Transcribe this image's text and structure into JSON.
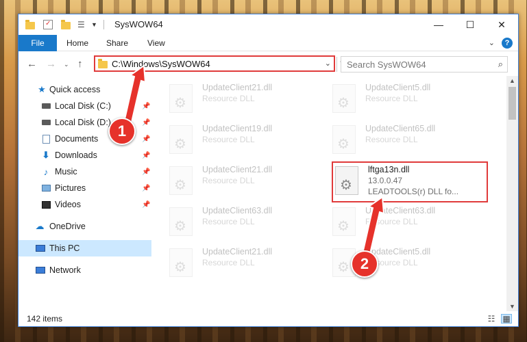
{
  "window": {
    "title": "SysWOW64",
    "controls": {
      "minimize": "—",
      "maximize": "☐",
      "close": "✕"
    }
  },
  "ribbon": {
    "tabs": [
      "File",
      "Home",
      "Share",
      "View"
    ],
    "help": "?"
  },
  "navigation": {
    "address": "C:\\Windows\\SysWOW64",
    "search_placeholder": "Search SysWOW64"
  },
  "sidebar": {
    "items": [
      {
        "label": "Quick access",
        "icon": "star-icon",
        "pinned": false
      },
      {
        "label": "Local Disk (C:)",
        "icon": "disk-icon",
        "pinned": true
      },
      {
        "label": "Local Disk (D:)",
        "icon": "disk-icon",
        "pinned": true
      },
      {
        "label": "Documents",
        "icon": "documents-icon",
        "pinned": true
      },
      {
        "label": "Downloads",
        "icon": "download-icon",
        "pinned": true
      },
      {
        "label": "Music",
        "icon": "music-icon",
        "pinned": true
      },
      {
        "label": "Pictures",
        "icon": "pictures-icon",
        "pinned": true
      },
      {
        "label": "Videos",
        "icon": "videos-icon",
        "pinned": true
      },
      {
        "label": "OneDrive",
        "icon": "cloud-icon",
        "pinned": false
      },
      {
        "label": "This PC",
        "icon": "computer-icon",
        "pinned": false,
        "selected": true
      },
      {
        "label": "Network",
        "icon": "network-icon",
        "pinned": false
      }
    ]
  },
  "files": [
    {
      "name": "UpdateClient21.dll",
      "type": "Resource DLL",
      "faded": true
    },
    {
      "name": "UpdateClient5.dll",
      "type": "Resource DLL",
      "faded": true
    },
    {
      "name": "UpdateClient19.dll",
      "type": "Resource DLL",
      "faded": true
    },
    {
      "name": "UpdateClient65.dll",
      "type": "Resource DLL",
      "faded": true
    },
    {
      "name": "UpdateClient21.dll",
      "type": "Resource DLL",
      "faded": true
    },
    {
      "name": "lftga13n.dll",
      "version": "13.0.0.47",
      "type": "LEADTOOLS(r) DLL fo...",
      "faded": false
    },
    {
      "name": "UpdateClient63.dll",
      "type": "Resource DLL",
      "faded": true
    },
    {
      "name": "UpdateClient63.dll",
      "type": "Resource DLL",
      "faded": true
    },
    {
      "name": "UpdateClient21.dll",
      "type": "Resource DLL",
      "faded": true
    },
    {
      "name": "UpdateClient5.dll",
      "type": "Resource DLL",
      "faded": true
    }
  ],
  "status": {
    "item_count": "142 items"
  },
  "annotations": {
    "step1": "1",
    "step2": "2"
  },
  "colors": {
    "accent": "#1979ca",
    "highlight": "#e03a3a",
    "selected": "#cce8ff"
  }
}
